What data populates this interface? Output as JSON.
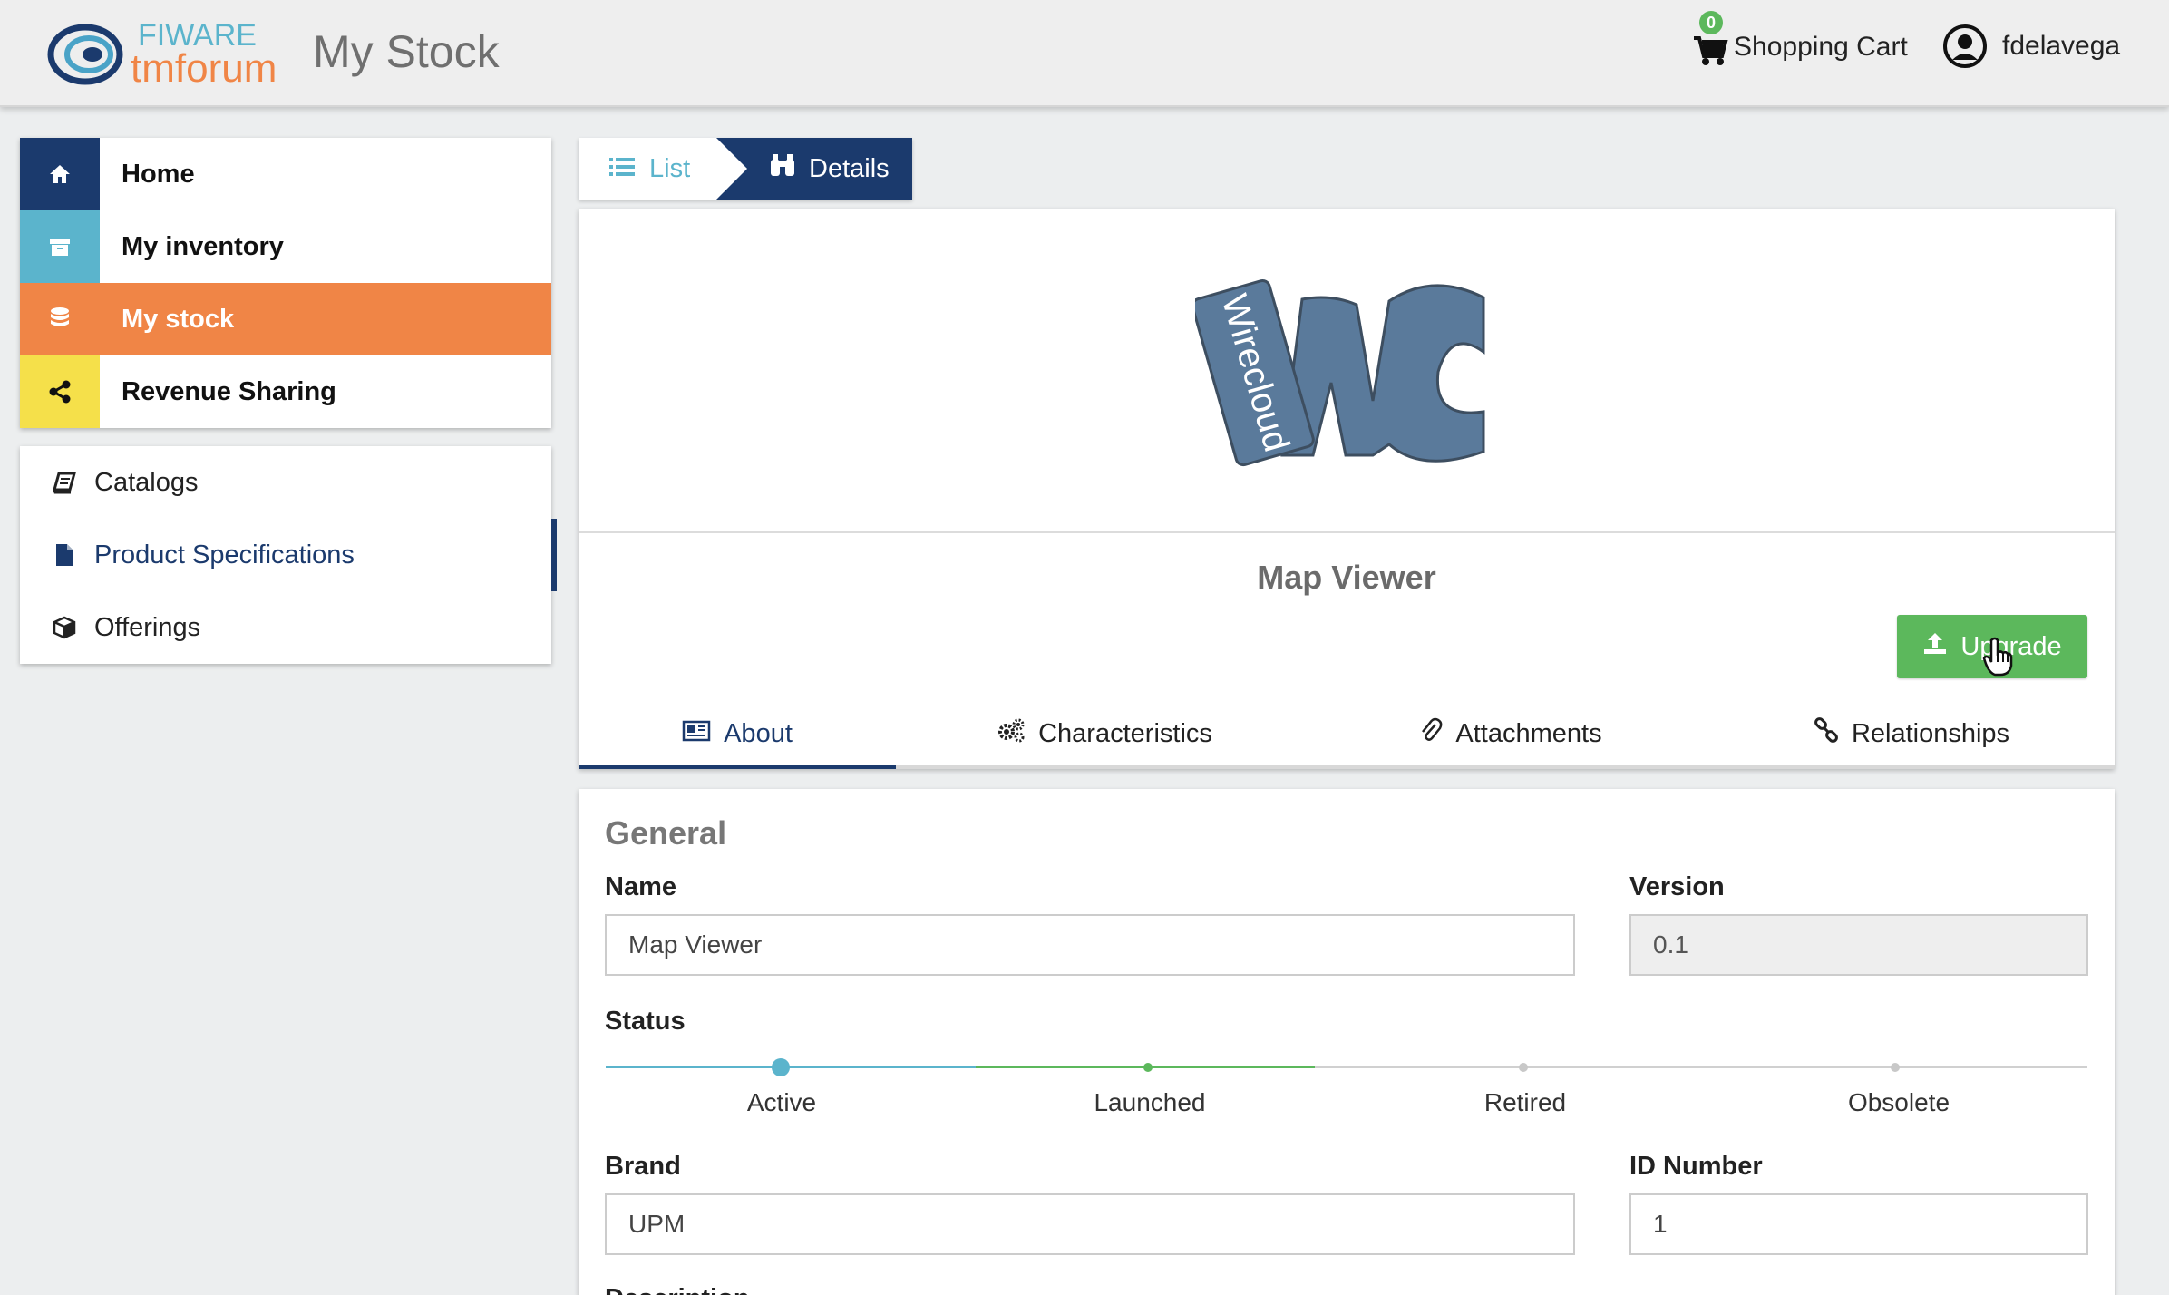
{
  "header": {
    "logo_top": "FIWARE",
    "logo_bottom": "tmforum",
    "page_title": "My Stock",
    "cart_count": "0",
    "cart_label": "Shopping Cart",
    "username": "fdelavega"
  },
  "sidebar": {
    "main_items": [
      {
        "label": "Home",
        "icon": "home-icon",
        "color": "#1b3a6d"
      },
      {
        "label": "My inventory",
        "icon": "archive-icon",
        "color": "#5bb4cc"
      },
      {
        "label": "My stock",
        "icon": "database-icon",
        "color": "#f08546"
      },
      {
        "label": "Revenue Sharing",
        "icon": "share-icon",
        "color": "#f5e04a"
      }
    ],
    "sub_items": [
      {
        "label": "Catalogs",
        "icon": "book-icon"
      },
      {
        "label": "Product Specifications",
        "icon": "file-icon"
      },
      {
        "label": "Offerings",
        "icon": "cube-icon"
      }
    ]
  },
  "breadcrumb": {
    "list_label": "List",
    "details_label": "Details"
  },
  "product": {
    "logo_text": "Wirecloud",
    "title": "Map Viewer",
    "upgrade_label": "Upgrade"
  },
  "tabs": [
    {
      "label": "About",
      "icon": "newspaper-icon"
    },
    {
      "label": "Characteristics",
      "icon": "cogs-icon"
    },
    {
      "label": "Attachments",
      "icon": "paperclip-icon"
    },
    {
      "label": "Relationships",
      "icon": "link-icon"
    }
  ],
  "general": {
    "section_title": "General",
    "name_label": "Name",
    "name_value": "Map Viewer",
    "version_label": "Version",
    "version_value": "0.1",
    "status_label": "Status",
    "status_steps": [
      "Active",
      "Launched",
      "Retired",
      "Obsolete"
    ],
    "brand_label": "Brand",
    "brand_value": "UPM",
    "id_label": "ID Number",
    "id_value": "1",
    "description_label_partial": "Description"
  },
  "colors": {
    "primary": "#1b3a6d",
    "accent_orange": "#f08546",
    "accent_teal": "#5bb4cc",
    "accent_yellow": "#f5e04a",
    "success_green": "#5cb85c"
  }
}
